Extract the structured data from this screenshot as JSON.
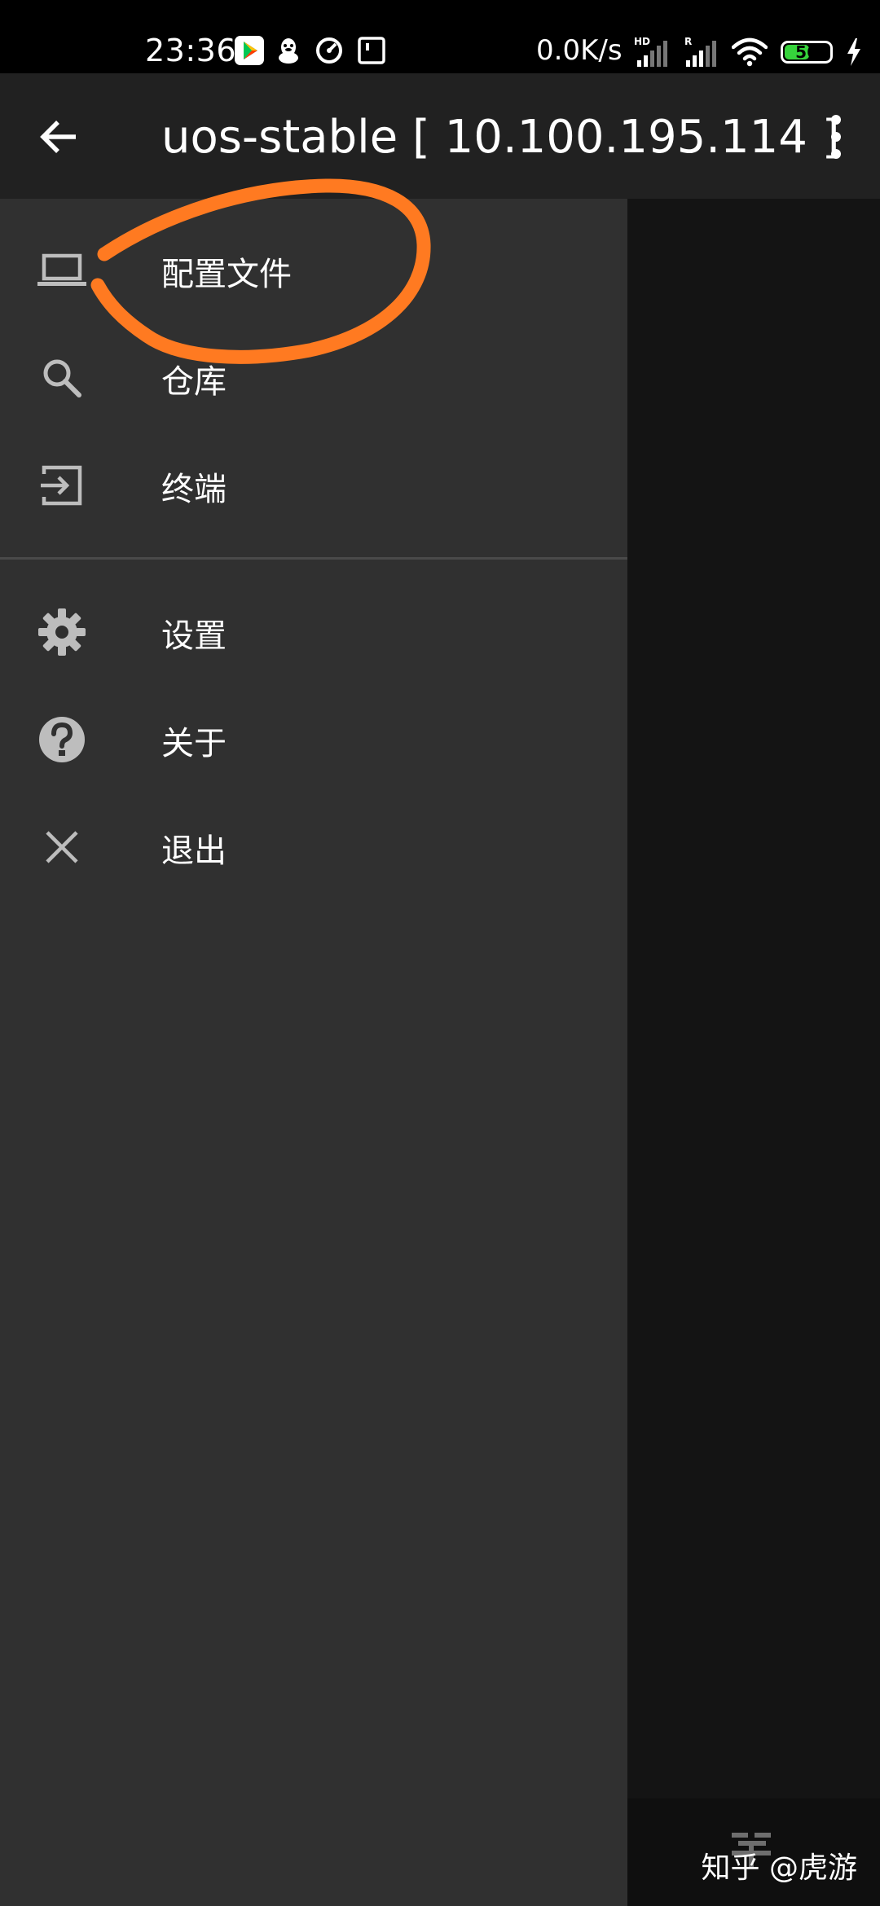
{
  "status_bar": {
    "time": "23:36",
    "net_speed": "0.0K/s",
    "signal1_label": "HD",
    "signal2_label": "R",
    "battery_level": "56",
    "battery_fraction": 0.56
  },
  "app_bar": {
    "title": "uos-stable  [ 10.100.195.114 ]"
  },
  "drawer": {
    "items": [
      {
        "label": "配置文件",
        "icon": "laptop-icon"
      },
      {
        "label": "仓库",
        "icon": "search-icon"
      },
      {
        "label": "终端",
        "icon": "exit-to-app-icon"
      },
      {
        "label": "设置",
        "icon": "gear-icon"
      },
      {
        "label": "关于",
        "icon": "help-icon"
      },
      {
        "label": "退出",
        "icon": "close-icon"
      }
    ]
  },
  "watermark": {
    "text": "知乎 @虎游"
  },
  "colors": {
    "drawer_bg": "#303030",
    "app_bar_bg": "#212121",
    "annotation": "#ff7a21",
    "icon": "#bdbdbd",
    "battery": "#36d43c"
  }
}
